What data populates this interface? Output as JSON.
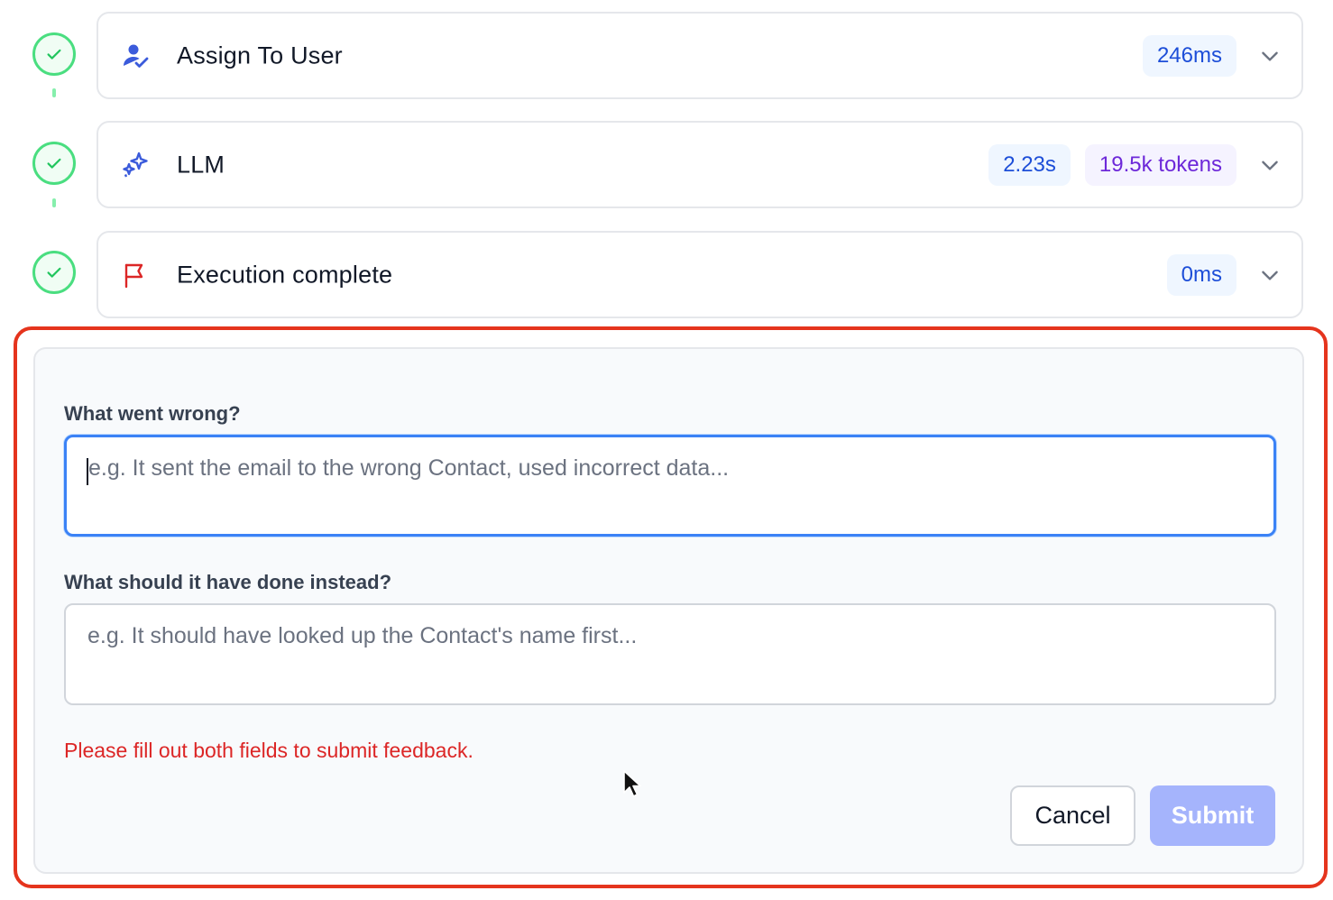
{
  "steps": [
    {
      "title": "Assign To User",
      "icon": "user-check-icon",
      "badges": [
        {
          "kind": "time",
          "text": "246ms"
        }
      ],
      "status": "complete"
    },
    {
      "title": "LLM",
      "icon": "sparkles-icon",
      "badges": [
        {
          "kind": "time",
          "text": "2.23s"
        },
        {
          "kind": "tokens",
          "text": "19.5k tokens"
        }
      ],
      "status": "complete"
    },
    {
      "title": "Execution complete",
      "icon": "flag-icon",
      "badges": [
        {
          "kind": "time",
          "text": "0ms"
        }
      ],
      "status": "complete"
    }
  ],
  "feedback": {
    "wrong_label": "What went wrong?",
    "wrong_placeholder": "e.g. It sent the email to the wrong Contact, used incorrect data...",
    "wrong_value": "",
    "instead_label": "What should it have done instead?",
    "instead_placeholder": "e.g. It should have looked up the Contact's name first...",
    "instead_value": "",
    "error": "Please fill out both fields to submit feedback.",
    "cancel_label": "Cancel",
    "submit_label": "Submit",
    "submit_disabled": true
  },
  "colors": {
    "success": "#4ade80",
    "highlight": "#e5341d",
    "error": "#dc2626",
    "focus": "#3b82f6",
    "submit_disabled": "#a5b4fc"
  }
}
